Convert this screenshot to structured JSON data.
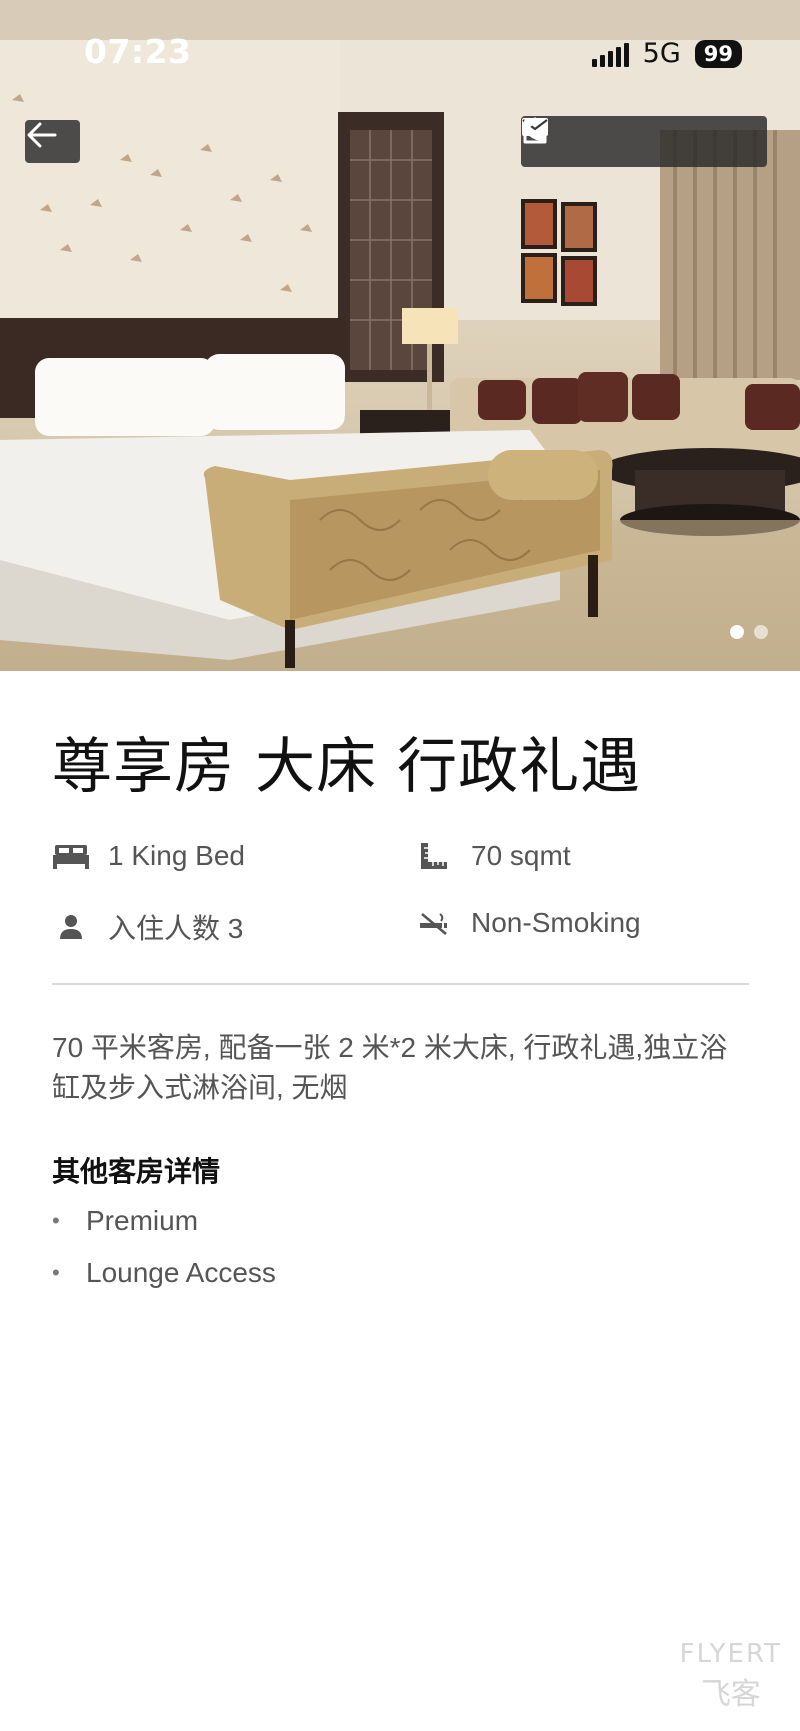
{
  "status_bar": {
    "time": "07:23",
    "network": "5G",
    "battery": "99"
  },
  "gallery": {
    "page_count": 2,
    "active_index": 0
  },
  "room": {
    "title": "尊享房 大床 行政礼遇",
    "amenities": {
      "bed": "1 King Bed",
      "size": "70 sqmt",
      "occupancy": "入住人数 3",
      "smoking": "Non-Smoking"
    },
    "description": "70 平米客房, 配备一张 2 米*2 米大床, 行政礼遇,独立浴缸及步入式淋浴间, 无烟",
    "details_heading": "其他客房详情",
    "details": [
      "Premium",
      "Lounge Access"
    ]
  },
  "watermark": {
    "line1": "FLYERT",
    "line2": "飞客"
  },
  "icons": {
    "back": "arrow-left-icon",
    "share": "share-icon",
    "email": "mail-icon",
    "phone": "phone-icon",
    "bed": "bed-icon",
    "size": "ruler-icon",
    "occupancy": "person-icon",
    "smoking": "no-smoking-icon"
  },
  "colors": {
    "overlay": "#282828",
    "text_primary": "#111111",
    "text_secondary": "#555555",
    "divider": "#d9d9d9"
  }
}
